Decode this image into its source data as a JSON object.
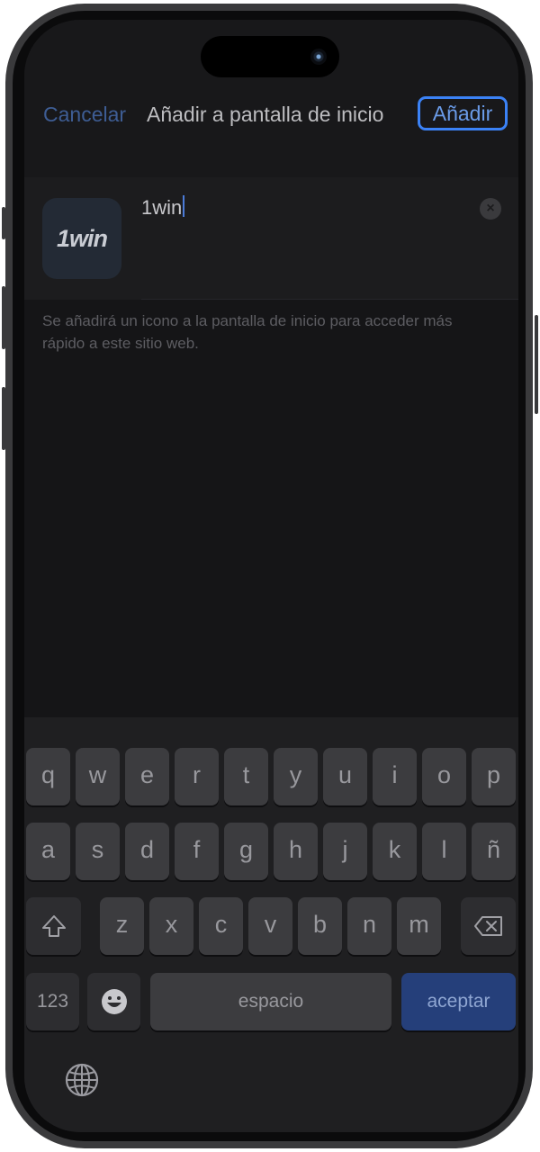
{
  "header": {
    "cancel_label": "Cancelar",
    "title": "Añadir a pantalla de inicio",
    "add_label": "Añadir"
  },
  "app": {
    "icon_text": "1win",
    "name_value": "1win"
  },
  "hint": "Se añadirá un icono a la pantalla de inicio para acceder más rápido a este sitio web.",
  "keyboard": {
    "row1": [
      "q",
      "w",
      "e",
      "r",
      "t",
      "y",
      "u",
      "i",
      "o",
      "p"
    ],
    "row2": [
      "a",
      "s",
      "d",
      "f",
      "g",
      "h",
      "j",
      "k",
      "l",
      "ñ"
    ],
    "row3": [
      "z",
      "x",
      "c",
      "v",
      "b",
      "n",
      "m"
    ],
    "numbers_label": "123",
    "space_label": "espacio",
    "return_label": "aceptar"
  },
  "colors": {
    "accent": "#3b82f6",
    "return_key": "#253f7a",
    "background": "#151517"
  },
  "icons": [
    "shift-icon",
    "delete-icon",
    "emoji-icon",
    "globe-icon",
    "clear-icon"
  ]
}
